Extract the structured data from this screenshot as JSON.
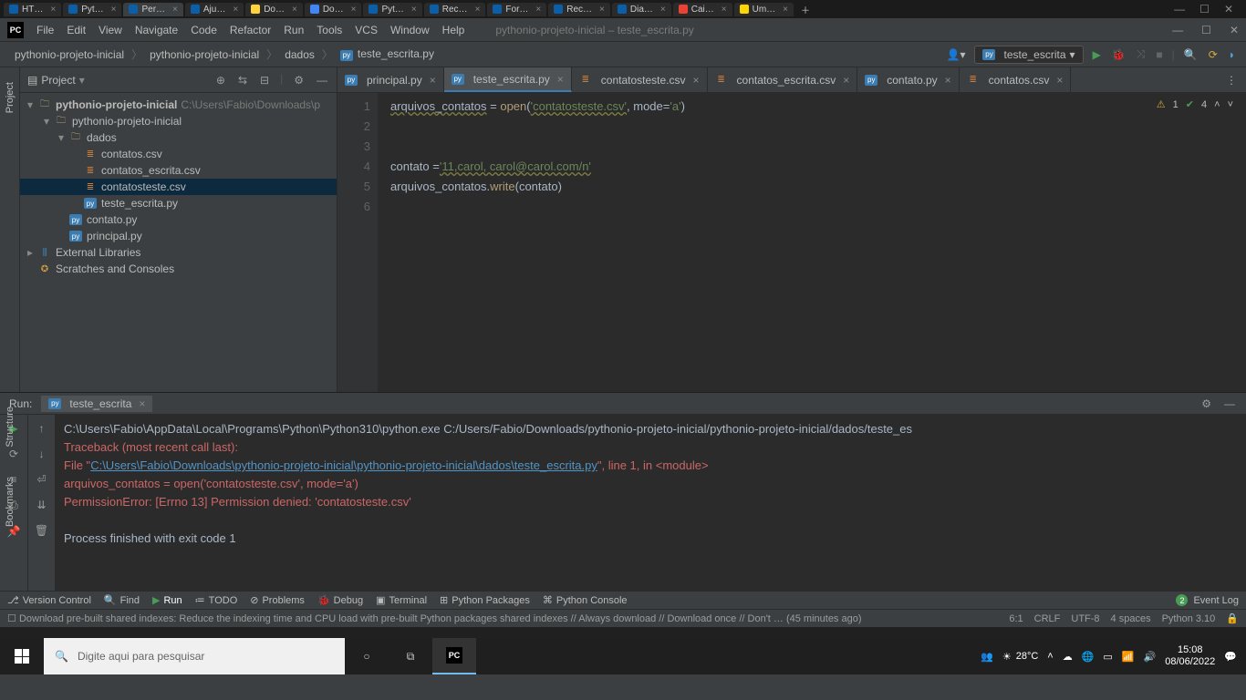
{
  "browser_tabs": [
    "HT…",
    "Pyt…",
    "Per…",
    "Aju…",
    "Do…",
    "Do…",
    "Pyt…",
    "Rec…",
    "For…",
    "Rec…",
    "Dia…",
    "Cai…",
    "Um…"
  ],
  "menu": [
    "File",
    "Edit",
    "View",
    "Navigate",
    "Code",
    "Refactor",
    "Run",
    "Tools",
    "VCS",
    "Window",
    "Help"
  ],
  "app_title": "pythonio-projeto-inicial – teste_escrita.py",
  "breadcrumb": [
    "pythonio-projeto-inicial",
    "pythonio-projeto-inicial",
    "dados",
    "teste_escrita.py"
  ],
  "run_config": "teste_escrita",
  "project_label": "Project",
  "tree": {
    "root": "pythonio-projeto-inicial",
    "root_path": "C:\\Users\\Fabio\\Downloads\\p",
    "sub": "pythonio-projeto-inicial",
    "dados": "dados",
    "files_dados": [
      "contatos.csv",
      "contatos_escrita.csv",
      "contatosteste.csv",
      "teste_escrita.py"
    ],
    "files_root": [
      "contato.py",
      "principal.py"
    ],
    "ext_lib": "External Libraries",
    "scratches": "Scratches and Consoles"
  },
  "editor_tabs": [
    {
      "label": "principal.py",
      "type": "py"
    },
    {
      "label": "teste_escrita.py",
      "type": "py",
      "active": true
    },
    {
      "label": "contatosteste.csv",
      "type": "csv"
    },
    {
      "label": "contatos_escrita.csv",
      "type": "csv"
    },
    {
      "label": "contato.py",
      "type": "py"
    },
    {
      "label": "contatos.csv",
      "type": "csv"
    }
  ],
  "code": {
    "l1_var": "arquivos_contatos",
    "l1_fn": "open",
    "l1_str1": "'contatosteste.csv'",
    "l1_kw": "mode",
    "l1_str2": "'a'",
    "l4_var": "contato",
    "l4_str": "'11,carol, carol@carol.com/n'",
    "l5_obj": "arquivos_contatos",
    "l5_m": "write",
    "l5_arg": "contato"
  },
  "indicators": {
    "warn": "1",
    "check": "4"
  },
  "run": {
    "label": "Run:",
    "tab": "teste_escrita",
    "cmd": "C:\\Users\\Fabio\\AppData\\Local\\Programs\\Python\\Python310\\python.exe C:/Users/Fabio/Downloads/pythonio-projeto-inicial/pythonio-projeto-inicial/dados/teste_es",
    "trace1": "Traceback (most recent call last):",
    "trace2a": "  File \"",
    "trace2link": "C:\\Users\\Fabio\\Downloads\\pythonio-projeto-inicial\\pythonio-projeto-inicial\\dados\\teste_escrita.py",
    "trace2b": "\", line 1, in <module>",
    "trace3": "    arquivos_contatos = open('contatosteste.csv', mode='a')",
    "trace4": "PermissionError: [Errno 13] Permission denied: 'contatosteste.csv'",
    "exit": "Process finished with exit code 1"
  },
  "bottom": {
    "vc": "Version Control",
    "find": "Find",
    "run": "Run",
    "todo": "TODO",
    "problems": "Problems",
    "debug": "Debug",
    "terminal": "Terminal",
    "pypkg": "Python Packages",
    "pycon": "Python Console",
    "eventlog": "Event Log",
    "badge": "2"
  },
  "status": {
    "msg": "Download pre-built shared indexes: Reduce the indexing time and CPU load with pre-built Python packages shared indexes // Always download // Download once // Don't … (45 minutes ago)",
    "pos": "6:1",
    "eol": "CRLF",
    "enc": "UTF-8",
    "indent": "4 spaces",
    "python": "Python 3.10"
  },
  "side_tabs": {
    "structure": "Structure",
    "bookmarks": "Bookmarks"
  },
  "taskbar": {
    "search_placeholder": "Digite aqui para pesquisar",
    "temp": "28°C",
    "time": "15:08",
    "date": "08/06/2022"
  }
}
